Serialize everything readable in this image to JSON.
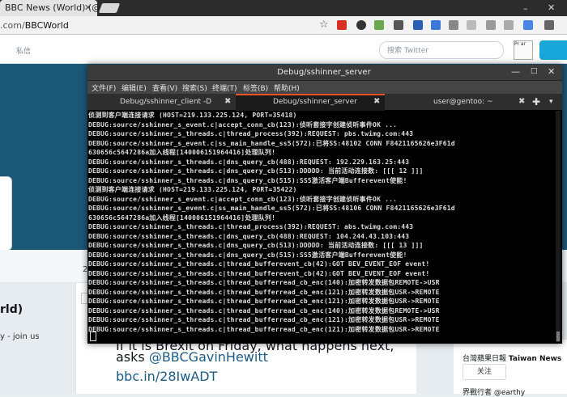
{
  "browser": {
    "tab_title": "BBC News (World) (@",
    "tab_close": "✕",
    "url_prefix": ".com/",
    "url_path": "BBCWorld",
    "star": "☆",
    "window_min": "–",
    "window_close": "✕"
  },
  "twitter": {
    "messages_label": "私信",
    "search_placeholder": "搜索 Twitter",
    "avatar_alt": "Pr ar",
    "profile_name": "rld)",
    "profile_bio": "y - join us",
    "nav_number": "2",
    "tweet_line1": "If it is Brexit on Friday, what happens next,",
    "tweet_line2_mention": "@BBCGavinHewitt",
    "tweet_line2_prefix": "asks ",
    "tweet_link": "bbc.in/28IwADT",
    "side_account": "台灣蘋果日報",
    "side_account_en": "Taiwan News",
    "side_follow": "关注",
    "side_account2": "界戰行者 @earthy"
  },
  "terminal": {
    "title": "Debug/sshinner_server",
    "menus": [
      "文件(F)",
      "编辑(E)",
      "查看(V)",
      "搜索(S)",
      "终端(T)",
      "标签(B)",
      "帮助(H)"
    ],
    "tabs": [
      {
        "label": "Debug/sshinner_client -D",
        "close": "✖"
      },
      {
        "label": "Debug/sshinner_server",
        "close": "✖"
      },
      {
        "label": "user@gentoo: ~",
        "close": "✖"
      }
    ],
    "new_tab": "✚",
    "tab_menu": "▾",
    "win_min": "—",
    "win_max": "□",
    "win_close": "✕",
    "lines": [
      "侦测到客户端连接请求 (HOST=219.133.225.124, PORT=35418)",
      "DEBUG:source/sshinner_s_event.c|accept_conn_cb(123):侦听套接字创建侦听事件OK ...",
      "DEBUG:source/sshinner_s_threads.c|thread_process(392):REQUEST: pbs.twimg.com:443",
      "DEBUG:source/sshinner_s_event.c|ss_main_handle_ss5(572):已将SS:48102 CONN F8421165626e3F61d630656c5647286a加入线程[140006151964416]处理队列!",
      "DEBUG:source/sshinner_s_threads.c|dns_query_cb(488):REQUEST: 192.229.163.25:443",
      "DEBUG:source/sshinner_s_threads.c|dns_query_cb(513):DDDDD: 当前活动连接数: [[[ 12 ]]]",
      "DEBUG:source/sshinner_s_threads.c|dns_query_cb(515):SS5激活客户端Bufferevent使能!",
      "侦测到客户端连接请求 (HOST=219.133.225.124, PORT=35422)",
      "DEBUG:source/sshinner_s_event.c|accept_conn_cb(123):侦听套接字创建侦听事件OK ...",
      "DEBUG:source/sshinner_s_event.c|ss_main_handle_ss5(572):已将SS:48106 CONN F8421165626e3F61d630656c5647286a加入线程[140006151964416]处理队列!",
      "DEBUG:source/sshinner_s_threads.c|thread_process(392):REQUEST: abs.twimg.com:443",
      "DEBUG:source/sshinner_s_threads.c|dns_query_cb(488):REQUEST: 104.244.43.103:443",
      "DEBUG:source/sshinner_s_threads.c|dns_query_cb(513):DDDDD: 当前活动连接数: [[[ 13 ]]]",
      "DEBUG:source/sshinner_s_threads.c|dns_query_cb(515):SS5激活客户端Bufferevent使能!",
      "DEBUG:source/sshinner_s_threads.c|thread_bufferevent_cb(42):GOT BEV_EVENT_EOF event!",
      "DEBUG:source/sshinner_s_threads.c|thread_bufferevent_cb(42):GOT BEV_EVENT_EOF event!",
      "DEBUG:source/sshinner_s_threads.c|thread_bufferread_cb_enc(140):加密转发数据包REMOTE->USR",
      "DEBUG:source/sshinner_s_threads.c|thread_bufferread_cb_enc(121):加密转发数据包USR->REMOTE",
      "DEBUG:source/sshinner_s_threads.c|thread_bufferread_cb_enc(121):加密转发数据包USR->REMOTE",
      "DEBUG:source/sshinner_s_threads.c|thread_bufferread_cb_enc(140):加密转发数据包REMOTE->USR",
      "DEBUG:source/sshinner_s_threads.c|thread_bufferread_cb_enc(121):加密转发数据包USR->REMOTE",
      "DEBUG:source/sshinner_s_threads.c|thread_bufferread_cb_enc(121):加密转发数据包USR->REMOTE"
    ]
  },
  "colors": {
    "terminal_bg": "#000000",
    "terminal_text": "#dedede",
    "tab_accent": "#e95420",
    "twitter_banner": "#1b5878",
    "twitter_link": "#1b5b86"
  }
}
